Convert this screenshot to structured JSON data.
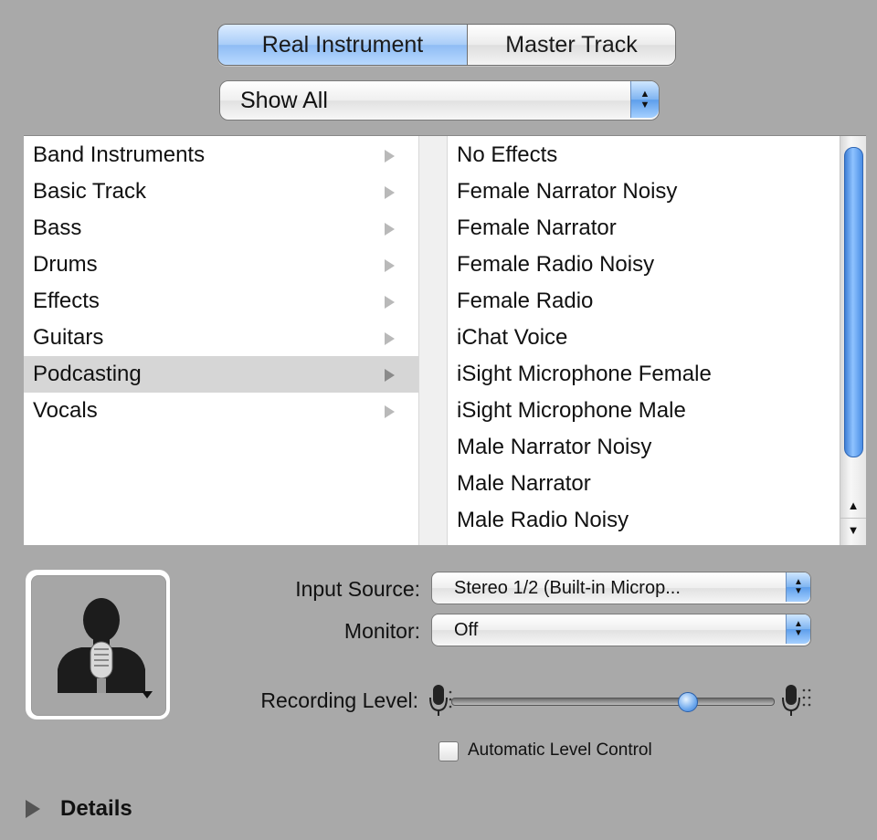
{
  "segmented": {
    "real_instrument": "Real Instrument",
    "master_track": "Master Track"
  },
  "filter_popup": {
    "value": "Show All"
  },
  "categories": [
    "Band Instruments",
    "Basic Track",
    "Bass",
    "Drums",
    "Effects",
    "Guitars",
    "Podcasting",
    "Vocals"
  ],
  "selected_category": "Podcasting",
  "presets": [
    "No Effects",
    "Female Narrator Noisy",
    "Female Narrator",
    "Female Radio Noisy",
    "Female Radio",
    "iChat Voice",
    "iSight Microphone Female",
    "iSight Microphone Male",
    "Male Narrator Noisy",
    "Male Narrator",
    "Male Radio Noisy"
  ],
  "input_source": {
    "label": "Input Source:",
    "value": "Stereo 1/2 (Built-in Microp..."
  },
  "monitor": {
    "label": "Monitor:",
    "value": "Off"
  },
  "recording_level": {
    "label": "Recording Level:",
    "level": 0.73
  },
  "auto_level": {
    "label": "Automatic Level Control",
    "checked": false
  },
  "details": {
    "label": "Details"
  },
  "colors": {
    "accent": "#8fbcf4",
    "background": "#a9a9a9",
    "selection": "#d6d6d6"
  }
}
